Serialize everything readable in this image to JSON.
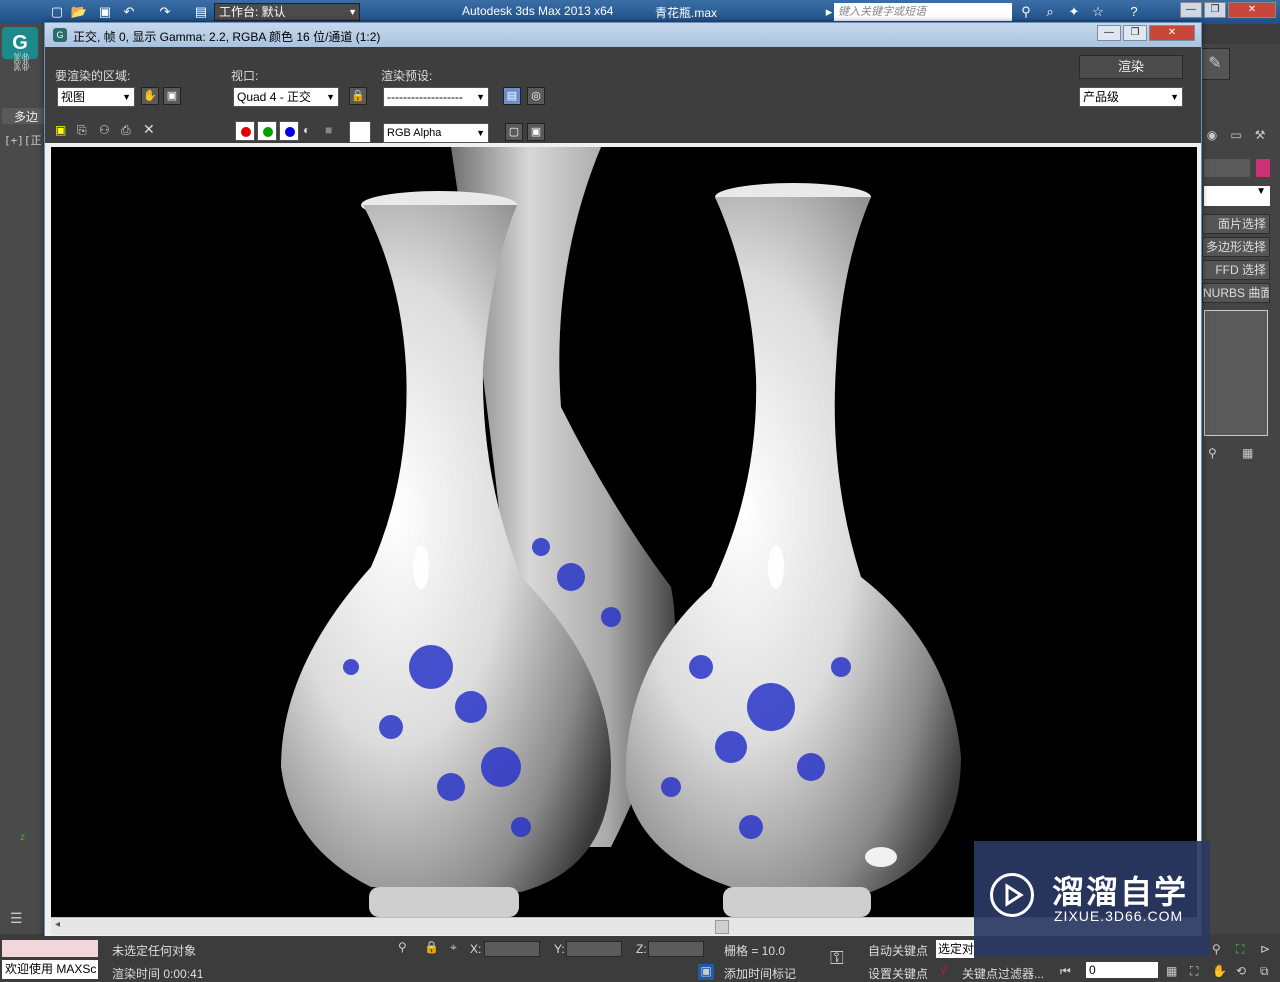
{
  "app": {
    "workspace_label": "工作台: 默认",
    "app_title": "Autodesk 3ds Max  2013 x64",
    "file_name": "青花瓶.max",
    "search_placeholder": "键入关键字或短语"
  },
  "left_strip": {
    "tab_label": "多边",
    "viewport_label": "[+][正"
  },
  "render_window": {
    "title": "正交, 帧 0, 显示 Gamma: 2.2, RGBA 颜色 16 位/通道 (1:2)",
    "area_label": "要渲染的区域:",
    "area_value": "视图",
    "viewport_label": "视口:",
    "viewport_value": "Quad 4 - 正交",
    "preset_label": "渲染预设:",
    "preset_value": "-------------------",
    "render_button": "渲染",
    "quality_value": "产品级",
    "channel_value": "RGB Alpha",
    "colors": {
      "red": "#e00000",
      "green": "#00a000",
      "blue": "#0000e0"
    }
  },
  "right_panel": {
    "items": [
      "面片选择",
      "多边形选择",
      "FFD 选择",
      "NURBS 曲面选择"
    ],
    "swatch_color": "#cc3377"
  },
  "status": {
    "maxscript_label": "欢迎使用 MAXSc",
    "selection_text": "未选定任何对象",
    "render_time": "渲染时间  0:00:41",
    "x_label": "X:",
    "y_label": "Y:",
    "z_label": "Z:",
    "grid_text": "栅格 = 10.0",
    "add_time_tag": "添加时间标记",
    "auto_key": "自动关键点",
    "set_key": "设置关键点",
    "selected_label": "选定对",
    "key_filters": "关键点过滤器...",
    "frame_value": "0"
  },
  "watermark": {
    "title": "溜溜自学",
    "url": "ZIXUE.3D66.COM"
  }
}
